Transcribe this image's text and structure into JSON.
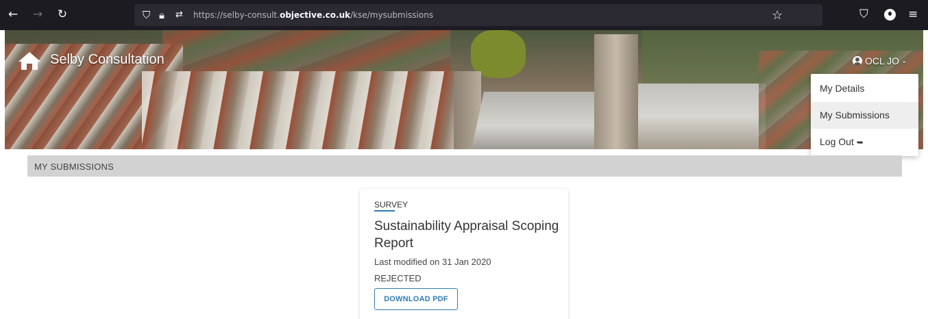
{
  "browser": {
    "back_icon": "arrow-left-icon",
    "forward_icon": "arrow-right-icon",
    "reload_icon": "reload-icon",
    "url_prefix": "https://selby-consult.",
    "url_domain": "objective.co.uk",
    "url_path": "/kse/mysubmissions"
  },
  "header": {
    "site_title": "Selby Consultation",
    "user_label": "OCL JO",
    "dropdown": {
      "items": [
        {
          "label": "My Details"
        },
        {
          "label": "My Submissions"
        },
        {
          "label": "Log Out"
        }
      ]
    }
  },
  "page": {
    "section_title": "MY SUBMISSIONS"
  },
  "submission": {
    "type": "SURVEY",
    "title": "Sustainability Appraisal Scoping Report",
    "modified": "Last modified on 31 Jan 2020",
    "status": "REJECTED",
    "download_label": "DOWNLOAD PDF"
  },
  "colors": {
    "accent": "#2e7bb8",
    "browser_bg": "#1c1b22",
    "section_bar": "#d2d2d2"
  }
}
